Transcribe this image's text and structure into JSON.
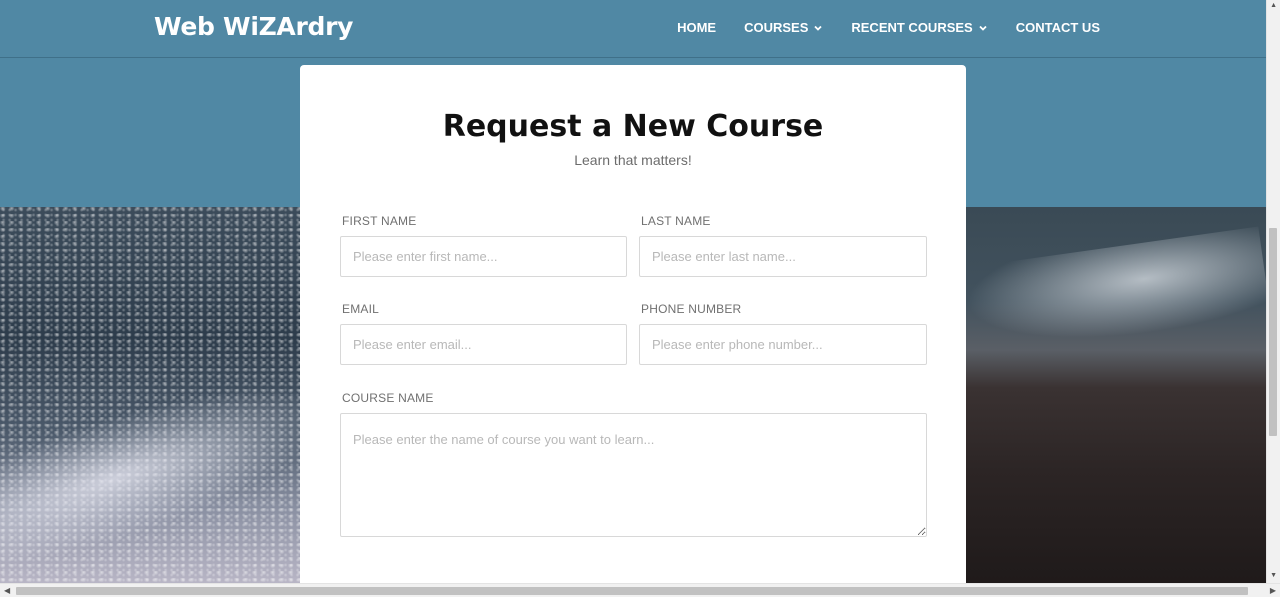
{
  "brand": "Web WiZArdry",
  "nav": [
    {
      "label": "HOME",
      "dropdown": false
    },
    {
      "label": "COURSES",
      "dropdown": true
    },
    {
      "label": "RECENT COURSES",
      "dropdown": true
    },
    {
      "label": "CONTACT US",
      "dropdown": false
    }
  ],
  "form": {
    "title": "Request a New Course",
    "subtitle": "Learn that matters!",
    "first_name": {
      "label": "FIRST NAME",
      "placeholder": "Please enter first name..."
    },
    "last_name": {
      "label": "LAST NAME",
      "placeholder": "Please enter last name..."
    },
    "email": {
      "label": "EMAIL",
      "placeholder": "Please enter email..."
    },
    "phone": {
      "label": "PHONE NUMBER",
      "placeholder": "Please enter phone number..."
    },
    "course": {
      "label": "COURSE NAME",
      "placeholder": "Please enter the name of course you want to learn..."
    }
  },
  "colors": {
    "header": "#5088a4",
    "card": "#ffffff",
    "title": "#111111"
  }
}
